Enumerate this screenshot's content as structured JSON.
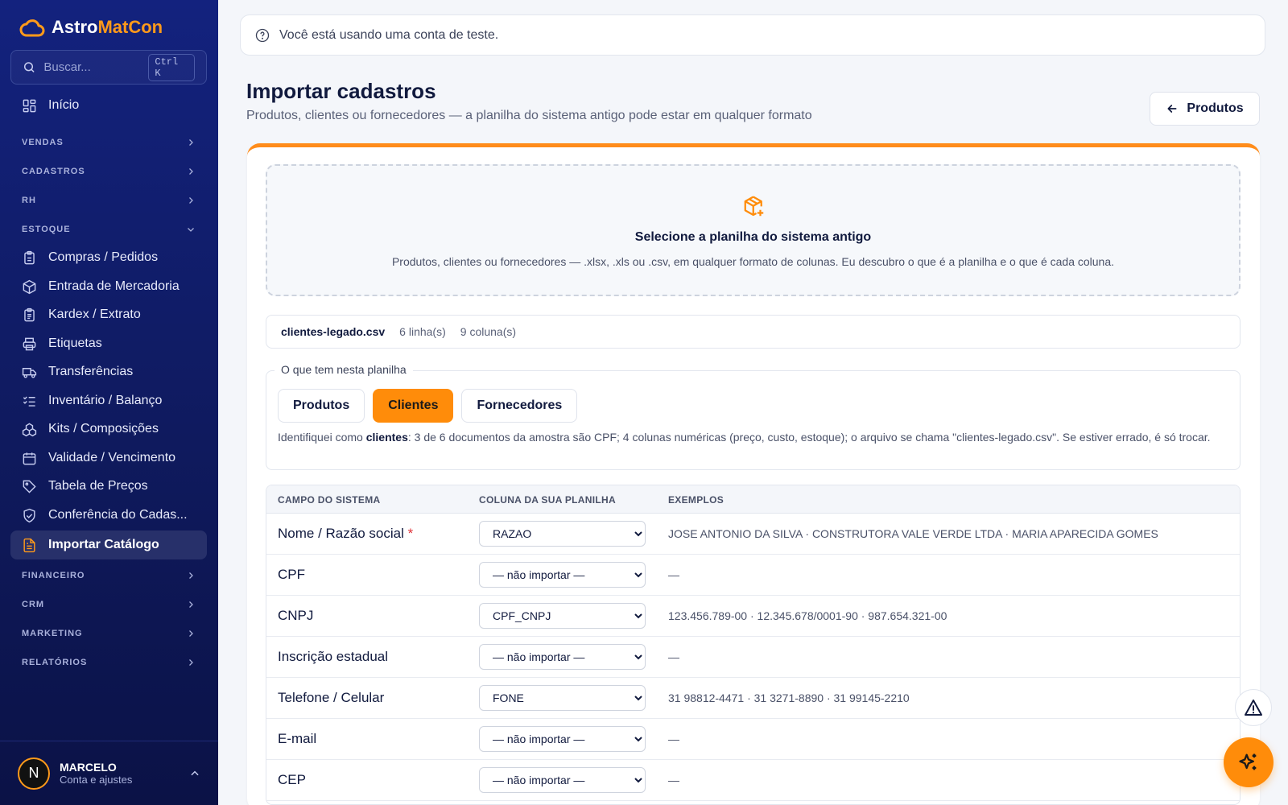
{
  "app": {
    "name_a": "Astro",
    "name_b": "MatCon"
  },
  "search": {
    "placeholder": "Buscar...",
    "shortcut": "Ctrl K"
  },
  "sidebar": {
    "home": "Início",
    "sections": [
      {
        "label": "VENDAS"
      },
      {
        "label": "CADASTROS"
      },
      {
        "label": "RH"
      },
      {
        "label": "ESTOQUE"
      },
      {
        "label": "FINANCEIRO"
      },
      {
        "label": "CRM"
      },
      {
        "label": "MARKETING"
      },
      {
        "label": "RELATÓRIOS"
      }
    ],
    "estoque_items": [
      {
        "label": "Compras / Pedidos",
        "icon": "clipboard-icon"
      },
      {
        "label": "Entrada de Mercadoria",
        "icon": "package-icon"
      },
      {
        "label": "Kardex / Extrato",
        "icon": "clipboard-list-icon"
      },
      {
        "label": "Etiquetas",
        "icon": "printer-icon"
      },
      {
        "label": "Transferências",
        "icon": "truck-icon"
      },
      {
        "label": "Inventário / Balanço",
        "icon": "list-checks-icon"
      },
      {
        "label": "Kits / Composições",
        "icon": "boxes-icon"
      },
      {
        "label": "Validade / Vencimento",
        "icon": "calendar-icon"
      },
      {
        "label": "Tabela de Preços",
        "icon": "tag-icon"
      },
      {
        "label": "Conferência do Cadas...",
        "icon": "shield-check-icon"
      },
      {
        "label": "Importar Catálogo",
        "icon": "file-import-icon",
        "active": true
      }
    ]
  },
  "user": {
    "initial": "N",
    "name": "MARCELO",
    "sub": "Conta e ajustes"
  },
  "banner": {
    "text": "Você está usando uma conta de teste."
  },
  "page": {
    "title": "Importar cadastros",
    "subtitle": "Produtos, clientes ou fornecedores — a planilha do sistema antigo pode estar em qualquer formato",
    "back_button": "Produtos"
  },
  "dropzone": {
    "title": "Selecione a planilha do sistema antigo",
    "desc": "Produtos, clientes ou fornecedores — .xlsx, .xls ou .csv, em qualquer formato de colunas. Eu descubro o que é a planilha e o que é cada coluna."
  },
  "file": {
    "name": "clientes-legado.csv",
    "rows": "6 linha(s)",
    "cols": "9 coluna(s)"
  },
  "kind": {
    "legend": "O que tem nesta planilha",
    "options": [
      "Produtos",
      "Clientes",
      "Fornecedores"
    ],
    "selected": "Clientes",
    "desc_pre": "Identifiquei como ",
    "desc_bold": "clientes",
    "desc_post": ": 3 de 6 documentos da amostra são CPF; 4 colunas numéricas (preço, custo, estoque); o arquivo se chama \"clientes-legado.csv\". Se estiver errado, é só trocar."
  },
  "mapping": {
    "headers": [
      "CAMPO DO SISTEMA",
      "COLUNA DA SUA PLANILHA",
      "EXEMPLOS"
    ],
    "rows": [
      {
        "field": "Nome / Razão social",
        "required": "*",
        "column": "RAZAO",
        "examples": "JOSE ANTONIO DA SILVA · CONSTRUTORA VALE VERDE LTDA · MARIA APARECIDA GOMES"
      },
      {
        "field": "CPF",
        "required": "",
        "column": "— não importar —",
        "examples": "—"
      },
      {
        "field": "CNPJ",
        "required": "",
        "column": "CPF_CNPJ",
        "examples": "123.456.789-00 · 12.345.678/0001-90 · 987.654.321-00"
      },
      {
        "field": "Inscrição estadual",
        "required": "",
        "column": "— não importar —",
        "examples": "—"
      },
      {
        "field": "Telefone / Celular",
        "required": "",
        "column": "FONE",
        "examples": "31 98812-4471 · 31 3271-8890 · 31 99145-2210"
      },
      {
        "field": "E-mail",
        "required": "",
        "column": "— não importar —",
        "examples": "—"
      },
      {
        "field": "CEP",
        "required": "",
        "column": "— não importar —",
        "examples": "—"
      }
    ]
  },
  "colors": {
    "accent": "#ff8c0a",
    "sidebar": "#13227e",
    "required": "#e0343a"
  }
}
